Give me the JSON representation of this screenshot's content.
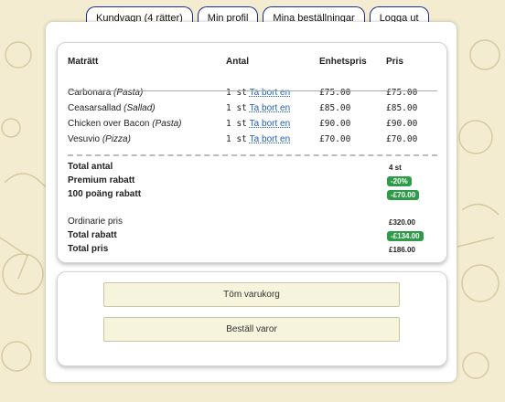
{
  "tabs": [
    {
      "label": "Kundvagn (4 rätter)"
    },
    {
      "label": "Min profil"
    },
    {
      "label": "Mina beställningar"
    },
    {
      "label": "Logga ut"
    }
  ],
  "cart": {
    "headers": {
      "dish": "Maträtt",
      "qty": "Antal",
      "unit_price": "Enhetspris",
      "price": "Pris"
    },
    "items": [
      {
        "name": "Carbonara",
        "category": "(Pasta)",
        "qty": "1 st",
        "remove": "Ta bort en",
        "unit_price": "£75.00",
        "price": "£75.00"
      },
      {
        "name": "Ceasarsallad",
        "category": "(Sallad)",
        "qty": "1 st",
        "remove": "Ta bort en",
        "unit_price": "£85.00",
        "price": "£85.00"
      },
      {
        "name": "Chicken over Bacon",
        "category": "(Pasta)",
        "qty": "1 st",
        "remove": "Ta bort en",
        "unit_price": "£90.00",
        "price": "£90.00"
      },
      {
        "name": "Vesuvio",
        "category": "(Pizza)",
        "qty": "1 st",
        "remove": "Ta bort en",
        "unit_price": "£70.00",
        "price": "£70.00"
      }
    ]
  },
  "summary": {
    "total_count_label": "Total antal",
    "total_count_value": "4 st",
    "premium_label": "Premium rabatt",
    "premium_value": "-20%",
    "points_label": "100 poäng rabatt",
    "points_value": "-£70.00",
    "ordinary_label": "Ordinarie pris",
    "ordinary_value": "£320.00",
    "total_discount_label": "Total rabatt",
    "total_discount_value": "-£134.00",
    "total_price_label": "Total pris",
    "total_price_value": "£186.00"
  },
  "actions": {
    "clear": "Töm varukorg",
    "order": "Beställ varor"
  },
  "colors": {
    "discount_badge": "#2e9b48",
    "tab_border": "#1a2b8c",
    "link": "#1a5fb4"
  }
}
